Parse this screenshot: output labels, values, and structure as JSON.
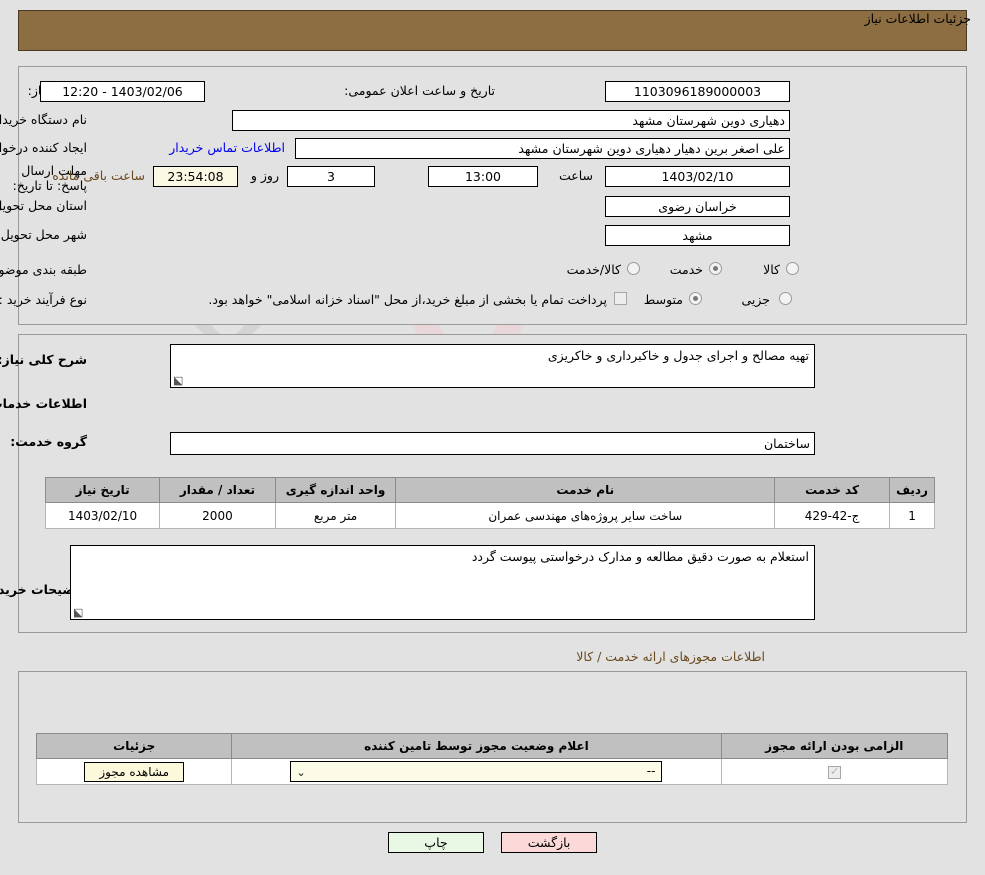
{
  "header": {
    "title": "جزئیات اطلاعات نیاز"
  },
  "top": {
    "need_number_label": "شماره نیاز:",
    "need_number_value": "1103096189000003",
    "announce_label": "تاریخ و ساعت اعلان عمومی:",
    "announce_value": "1403/02/06 - 12:20",
    "buyer_org_label": "نام دستگاه خریدار:",
    "buyer_org_value": "دهیاری دوین  شهرستان مشهد",
    "creator_label": "ایجاد کننده درخواست:",
    "creator_value": "علی اصغر برین دهیار دهیاری دوین  شهرستان مشهد",
    "contact_link": "اطلاعات تماس خریدار",
    "deadline_label": "مهلت ارسال پاسخ: تا تاریخ:",
    "deadline_date": "1403/02/10",
    "hour_label": "ساعت",
    "deadline_time": "13:00",
    "days_value": "3",
    "days_label": "روز و",
    "countdown_value": "23:54:08",
    "remaining_label": "ساعت باقی مانده",
    "province_label": "استان محل تحویل:",
    "province_value": "خراسان رضوی",
    "city_label": "شهر محل تحویل:",
    "city_value": "مشهد",
    "category_label": "طبقه بندی موضوعی:",
    "category_options": [
      {
        "label": "کالا",
        "selected": false
      },
      {
        "label": "خدمت",
        "selected": true
      },
      {
        "label": "کالا/خدمت",
        "selected": false
      }
    ],
    "process_label": "نوع فرآیند خرید :",
    "process_options": [
      {
        "label": "جزیی",
        "selected": false
      },
      {
        "label": "متوسط",
        "selected": true
      }
    ],
    "payment_checkbox_label": "پرداخت تمام یا بخشی از مبلغ خرید،از محل \"اسناد خزانه اسلامی\" خواهد بود.",
    "payment_checked": false
  },
  "mid": {
    "general_desc_label": "شرح کلی نیاز:",
    "general_desc_value": "تهیه مصالح و اجرای جدول و خاکبرداری و خاکریزی",
    "services_info_title": "اطلاعات خدمات مورد نیاز",
    "service_group_label": "گروه خدمت:",
    "service_group_value": "ساختمان",
    "buyer_notes_label": "توضیحات خریدار:",
    "buyer_notes_value": "استعلام به صورت دقیق مطالعه و مدارک درخواستی پیوست گردد"
  },
  "services_table": {
    "columns": [
      "ردیف",
      "کد خدمت",
      "نام خدمت",
      "واحد اندازه گیری",
      "تعداد / مقدار",
      "تاریخ نیاز"
    ],
    "rows": [
      {
        "row": "1",
        "code": "ج-42-429",
        "name": "ساخت سایر پروژه‌های مهندسی عمران",
        "unit": "متر مربع",
        "quantity": "2000",
        "date": "1403/02/10"
      }
    ]
  },
  "permits": {
    "section_title": "اطلاعات مجوزهای ارائه خدمت / کالا",
    "columns": [
      "الزامی بودن ارائه مجوز",
      "اعلام وضعیت مجوز توسط تامین کننده",
      "جزئیات"
    ],
    "rows": [
      {
        "required": true,
        "status_value": "--",
        "details_button": "مشاهده مجوز"
      }
    ]
  },
  "footer": {
    "print_button": "چاپ",
    "back_button": "بازگشت"
  },
  "colors": {
    "header_bar": "#8d6e43",
    "page_bg": "#e2e2e2",
    "link": "#0000ee",
    "label_brown": "#6a4a1f",
    "print_bg": "#e8f8e4",
    "back_bg": "#fcd9d9",
    "cream_field": "#fbf8e3"
  }
}
